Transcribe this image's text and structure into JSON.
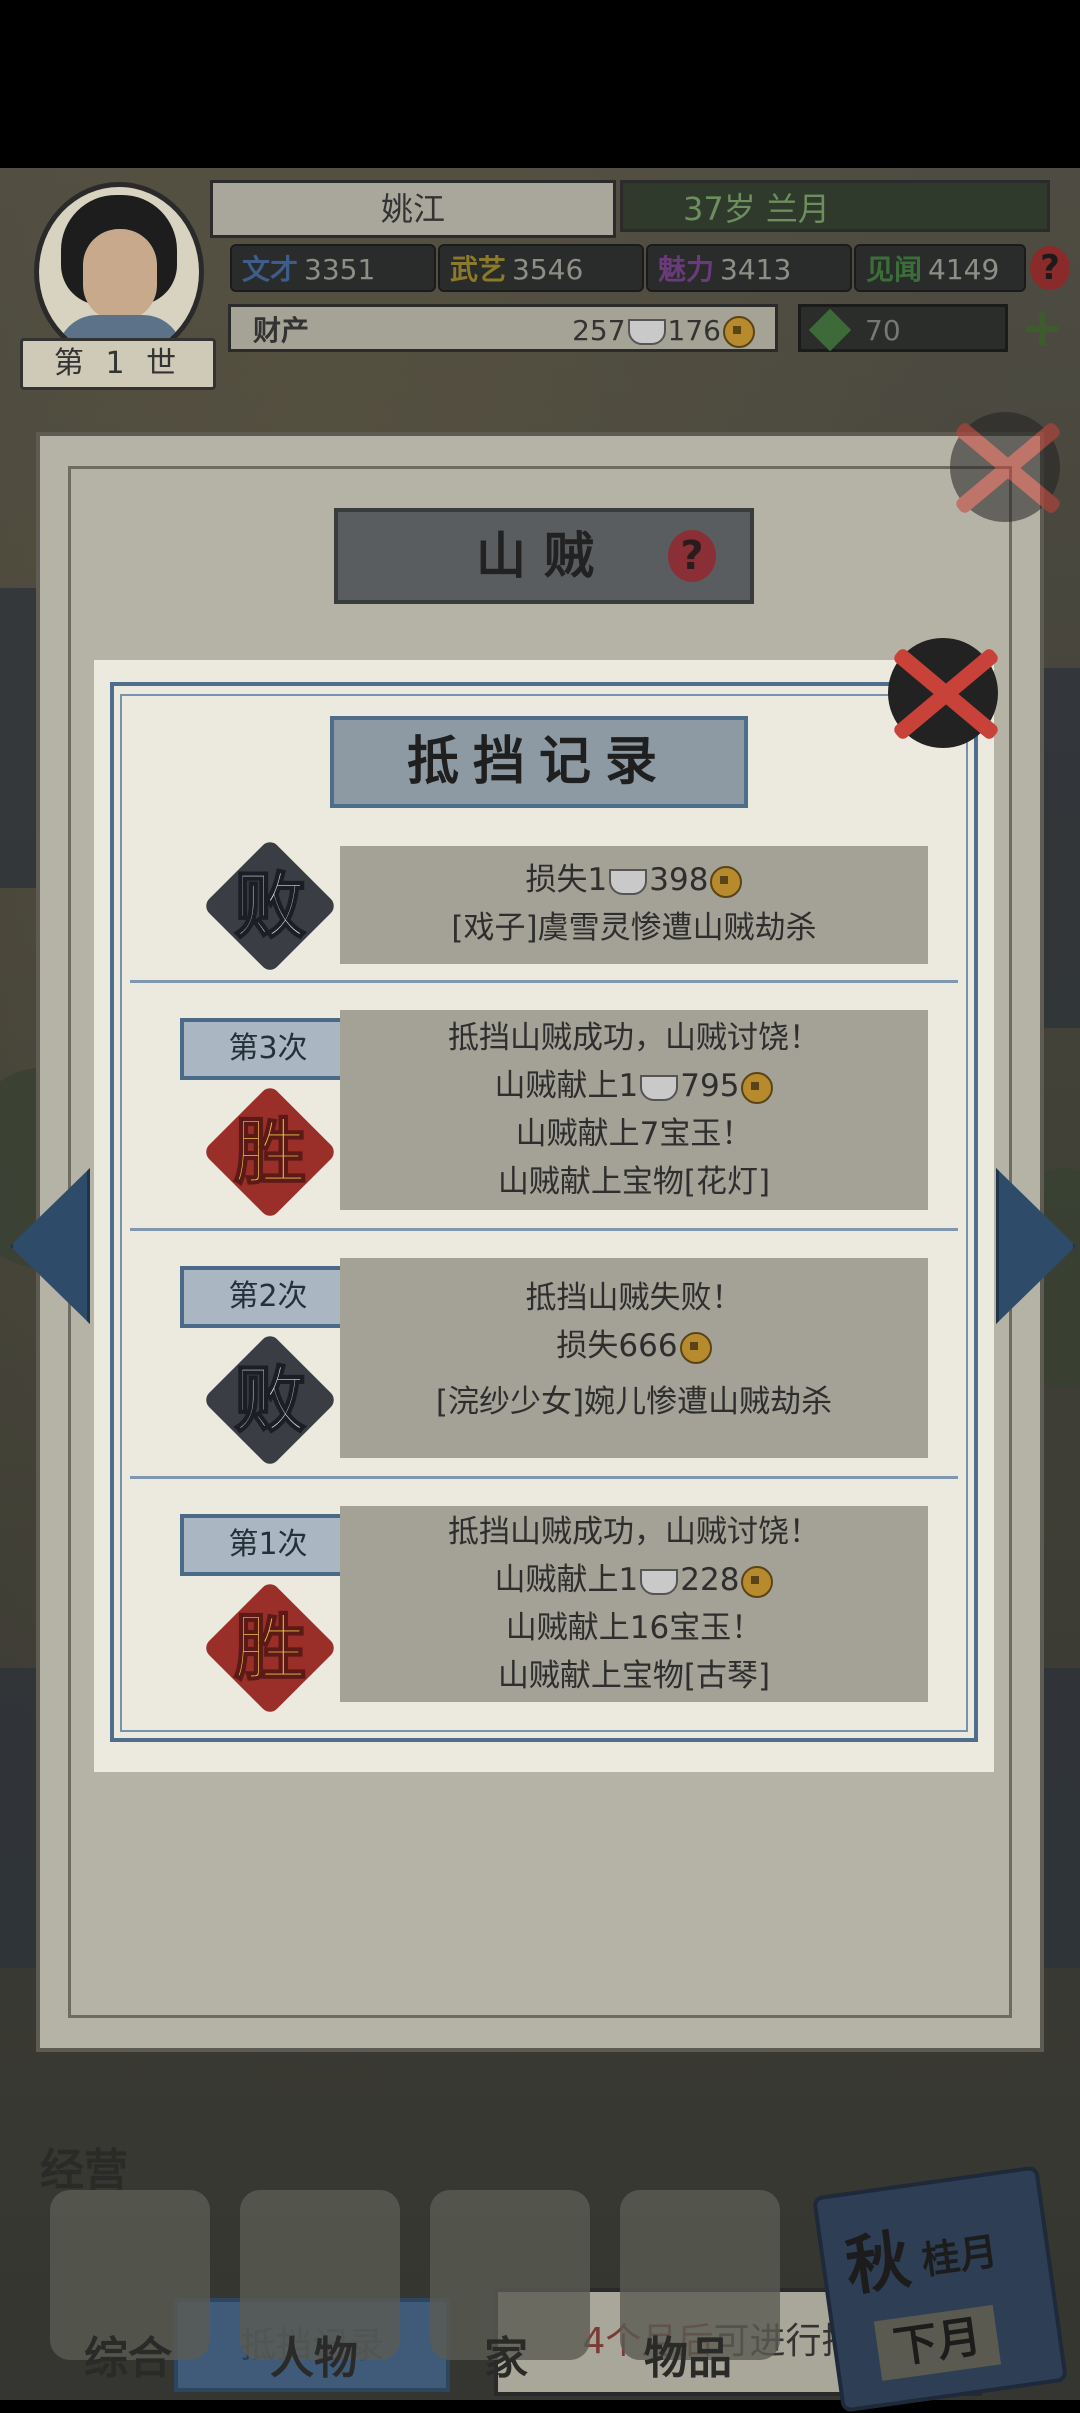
{
  "hud": {
    "name": "姚江",
    "age": "37岁 兰月",
    "generation": "第 1 世",
    "stats": [
      {
        "label": "文才",
        "value": "3351",
        "color": "#3e5d8a"
      },
      {
        "label": "武艺",
        "value": "3546",
        "color": "#8a7a2a"
      },
      {
        "label": "魅力",
        "value": "3413",
        "color": "#6a3a7a"
      },
      {
        "label": "见闻",
        "value": "4149",
        "color": "#3c6e3a"
      }
    ],
    "wealth_label": "财产",
    "silver": "257",
    "copper": "176",
    "jade": "70",
    "plus": "+"
  },
  "dialog": {
    "title": "山贼",
    "help": "?",
    "record_button": "抵挡记录",
    "defend_red": "4个月后",
    "defend_rest": "可进行抵挡"
  },
  "panel": {
    "title": "抵挡记录",
    "rows": [
      {
        "badge": "",
        "result": "败",
        "lines": [
          "损失1",
          "[戏子]虞雪灵惨遭山贼劫杀"
        ],
        "loss_copper": "398"
      },
      {
        "badge": "第3次",
        "result": "胜",
        "lines": [
          "抵挡山贼成功，山贼讨饶！",
          "山贼献上1",
          "山贼献上7宝玉！",
          "山贼献上宝物[花灯]"
        ],
        "copper": "795"
      },
      {
        "badge": "第2次",
        "result": "败",
        "lines": [
          "抵挡山贼失败！",
          "损失666",
          "[浣纱少女]婉儿惨遭山贼劫杀"
        ]
      },
      {
        "badge": "第1次",
        "result": "胜",
        "lines": [
          "抵挡山贼成功，山贼讨饶！",
          "山贼献上1",
          "山贼献上16宝玉！",
          "山贼献上宝物[古琴]"
        ],
        "copper": "228"
      }
    ]
  },
  "nav": {
    "section": "经营",
    "items": [
      "综合",
      "人物",
      "家",
      "物品"
    ],
    "season_big": "秋",
    "season_small": "桂月",
    "season_month": "下月"
  }
}
